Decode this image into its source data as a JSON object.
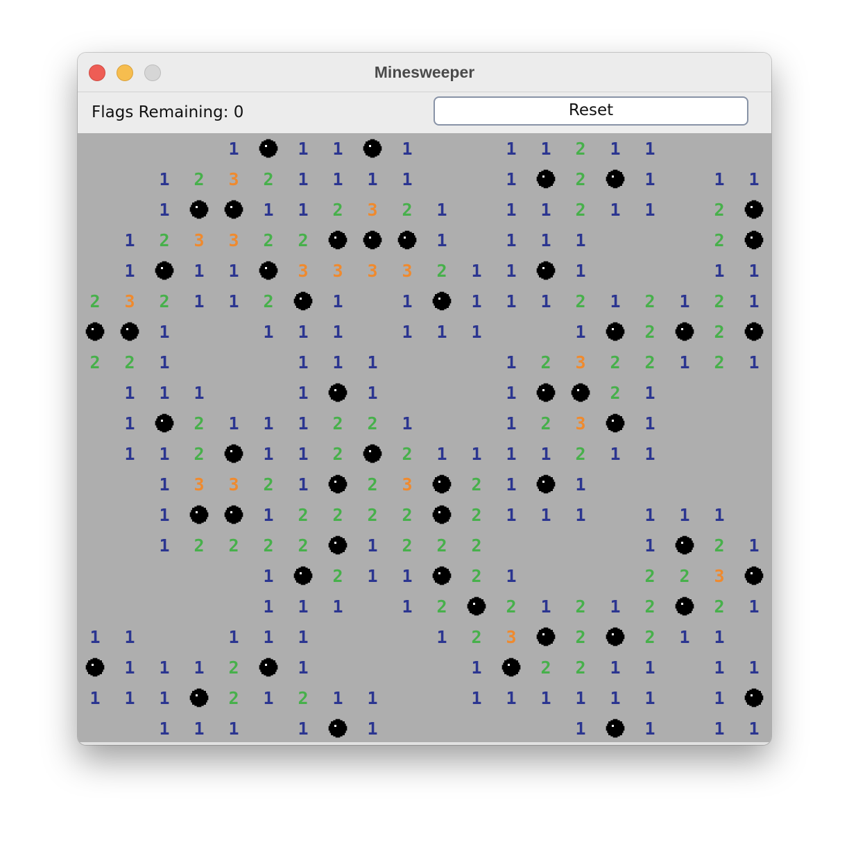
{
  "window": {
    "title": "Minesweeper"
  },
  "toolbar": {
    "flags_text": "Flags Remaining: 0",
    "reset_label": "Reset"
  },
  "colors": {
    "board": "#aeaeae",
    "one": "#2b3590",
    "two": "#47b04b",
    "three": "#ef8a2e",
    "mine": "#000000"
  },
  "icons": {
    "mine": "mine-icon"
  },
  "board": {
    "rows": 20,
    "cols": 20,
    "legend": "digit = adjacent mine count, * = mine, . = empty revealed cell",
    "grid": [
      "....1*11*1..11211...",
      "...12321111.1*2*1.11",
      "...1**11232.11211.2*",
      "..12332***1.111...2*",
      "..1*11*33332111*1..11",
      "232112*1.1*111212121",
      "**1..111.111..1*2*2*",
      "221...111...1232212",
      ".111..1*1...1**21...",
      ".1*21111221..123*1..",
      ".112*112*211112111..",
      "...1332 1*23*21*1...",
      "...1**1222 2*2111.111.",
      "...122 22*1222....1*21",
      "......1*211*21...223*",
      "......111.12*212121*21",
      "11..111...123*2*211.",
      "*111 2*1...1*22 11.11",
      "111*21211..11111 11.1*",
      "..111.1*1......1*1.11"
    ],
    "cells": [
      "....1*11*1..11211...",
      "...12321111.1*2*1.11",
      "...1**11232.11211.2*",
      ".12332***1.111...2*",
      ".1*11*33332111*1..11",
      "232112*1.1*111212121",
      "**1..111.111..1*2*2*",
      "221...111...12322121",
      ".111..1*1...1**21...",
      ".1*21111221..123*1..",
      ".112*112*21111121...",
      "...1332 1*23*21*1...",
      "...1**12222*2111.111",
      "...12222*1222....1*21",
      ".......1*211*21...223*",
      "......111.12*212121*21",
      "11..111....123*2*211.",
      "*1112*1...1*2211.11",
      "111*21211...1111111.1*",
      "...111.1*1......1*1.11"
    ]
  }
}
